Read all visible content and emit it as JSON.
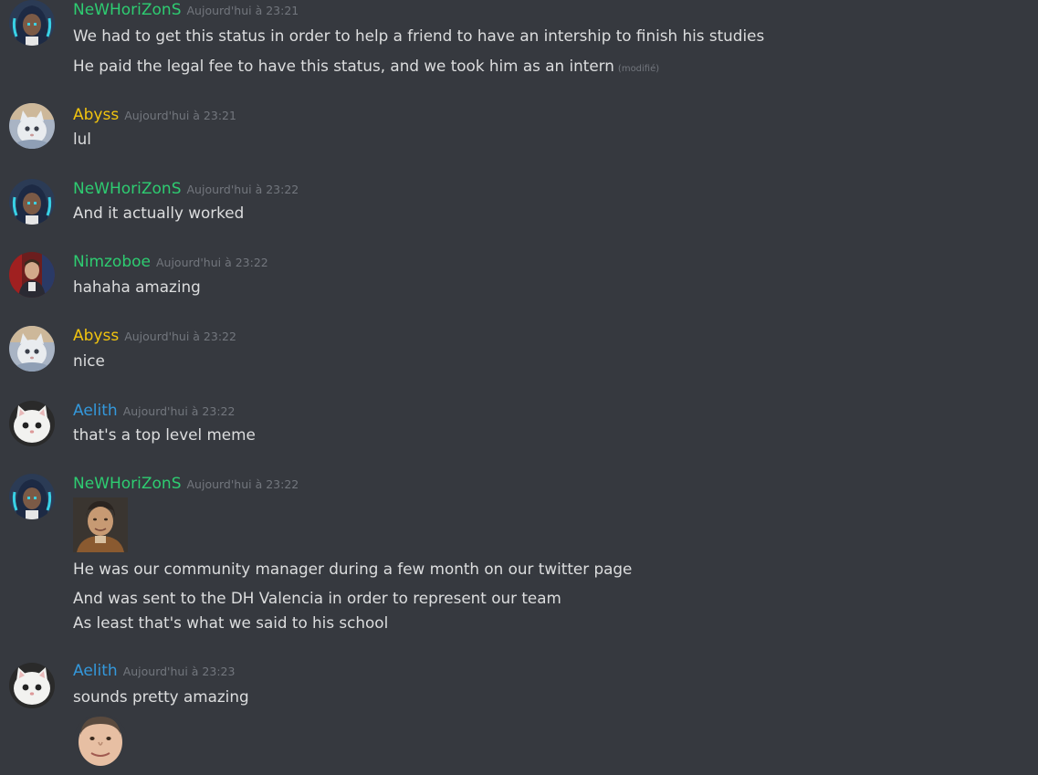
{
  "colors": {
    "background": "#36393f",
    "text": "#dcddde",
    "timestamp": "#72767d",
    "role_green": "#2ecc71",
    "role_yellow": "#f1c40f",
    "role_blue": "#3498db"
  },
  "messages": [
    {
      "author": "NeWHoriZonS",
      "avatar_icon": "anime-character-avatar",
      "timestamp": "Aujourd'hui à 23:21",
      "lines": [
        "We had to get this status in order to help a friend to have an intership to finish his studies",
        "He paid the legal fee to have this status, and we took him as an intern"
      ],
      "edited_label": "(modifié)"
    },
    {
      "author": "Abyss",
      "avatar_icon": "cat-avatar",
      "timestamp": "Aujourd'hui à 23:21",
      "lines": [
        "lul"
      ]
    },
    {
      "author": "NeWHoriZonS",
      "avatar_icon": "anime-character-avatar",
      "timestamp": "Aujourd'hui à 23:22",
      "lines": [
        "And it actually worked"
      ]
    },
    {
      "author": "Nimzoboe",
      "avatar_icon": "person-photo-avatar",
      "timestamp": "Aujourd'hui à 23:22",
      "lines": [
        "hahaha amazing"
      ]
    },
    {
      "author": "Abyss",
      "avatar_icon": "cat-avatar",
      "timestamp": "Aujourd'hui à 23:22",
      "lines": [
        "nice"
      ]
    },
    {
      "author": "Aelith",
      "avatar_icon": "white-kitten-avatar",
      "timestamp": "Aujourd'hui à 23:22",
      "lines": [
        "that's a top level meme"
      ]
    },
    {
      "author": "NeWHoriZonS",
      "avatar_icon": "anime-character-avatar",
      "timestamp": "Aujourd'hui à 23:22",
      "emote_icon": "man-portrait-emote",
      "lines": [
        "He was our community manager during a few month on our twitter page",
        "And was sent to the DH Valencia in order to represent our team",
        "As least that's what we said to his school"
      ]
    },
    {
      "author": "Aelith",
      "avatar_icon": "white-kitten-avatar",
      "timestamp": "Aujourd'hui à 23:23",
      "lines": [
        "sounds pretty amazing"
      ],
      "emote_icon": "face-emote"
    }
  ]
}
